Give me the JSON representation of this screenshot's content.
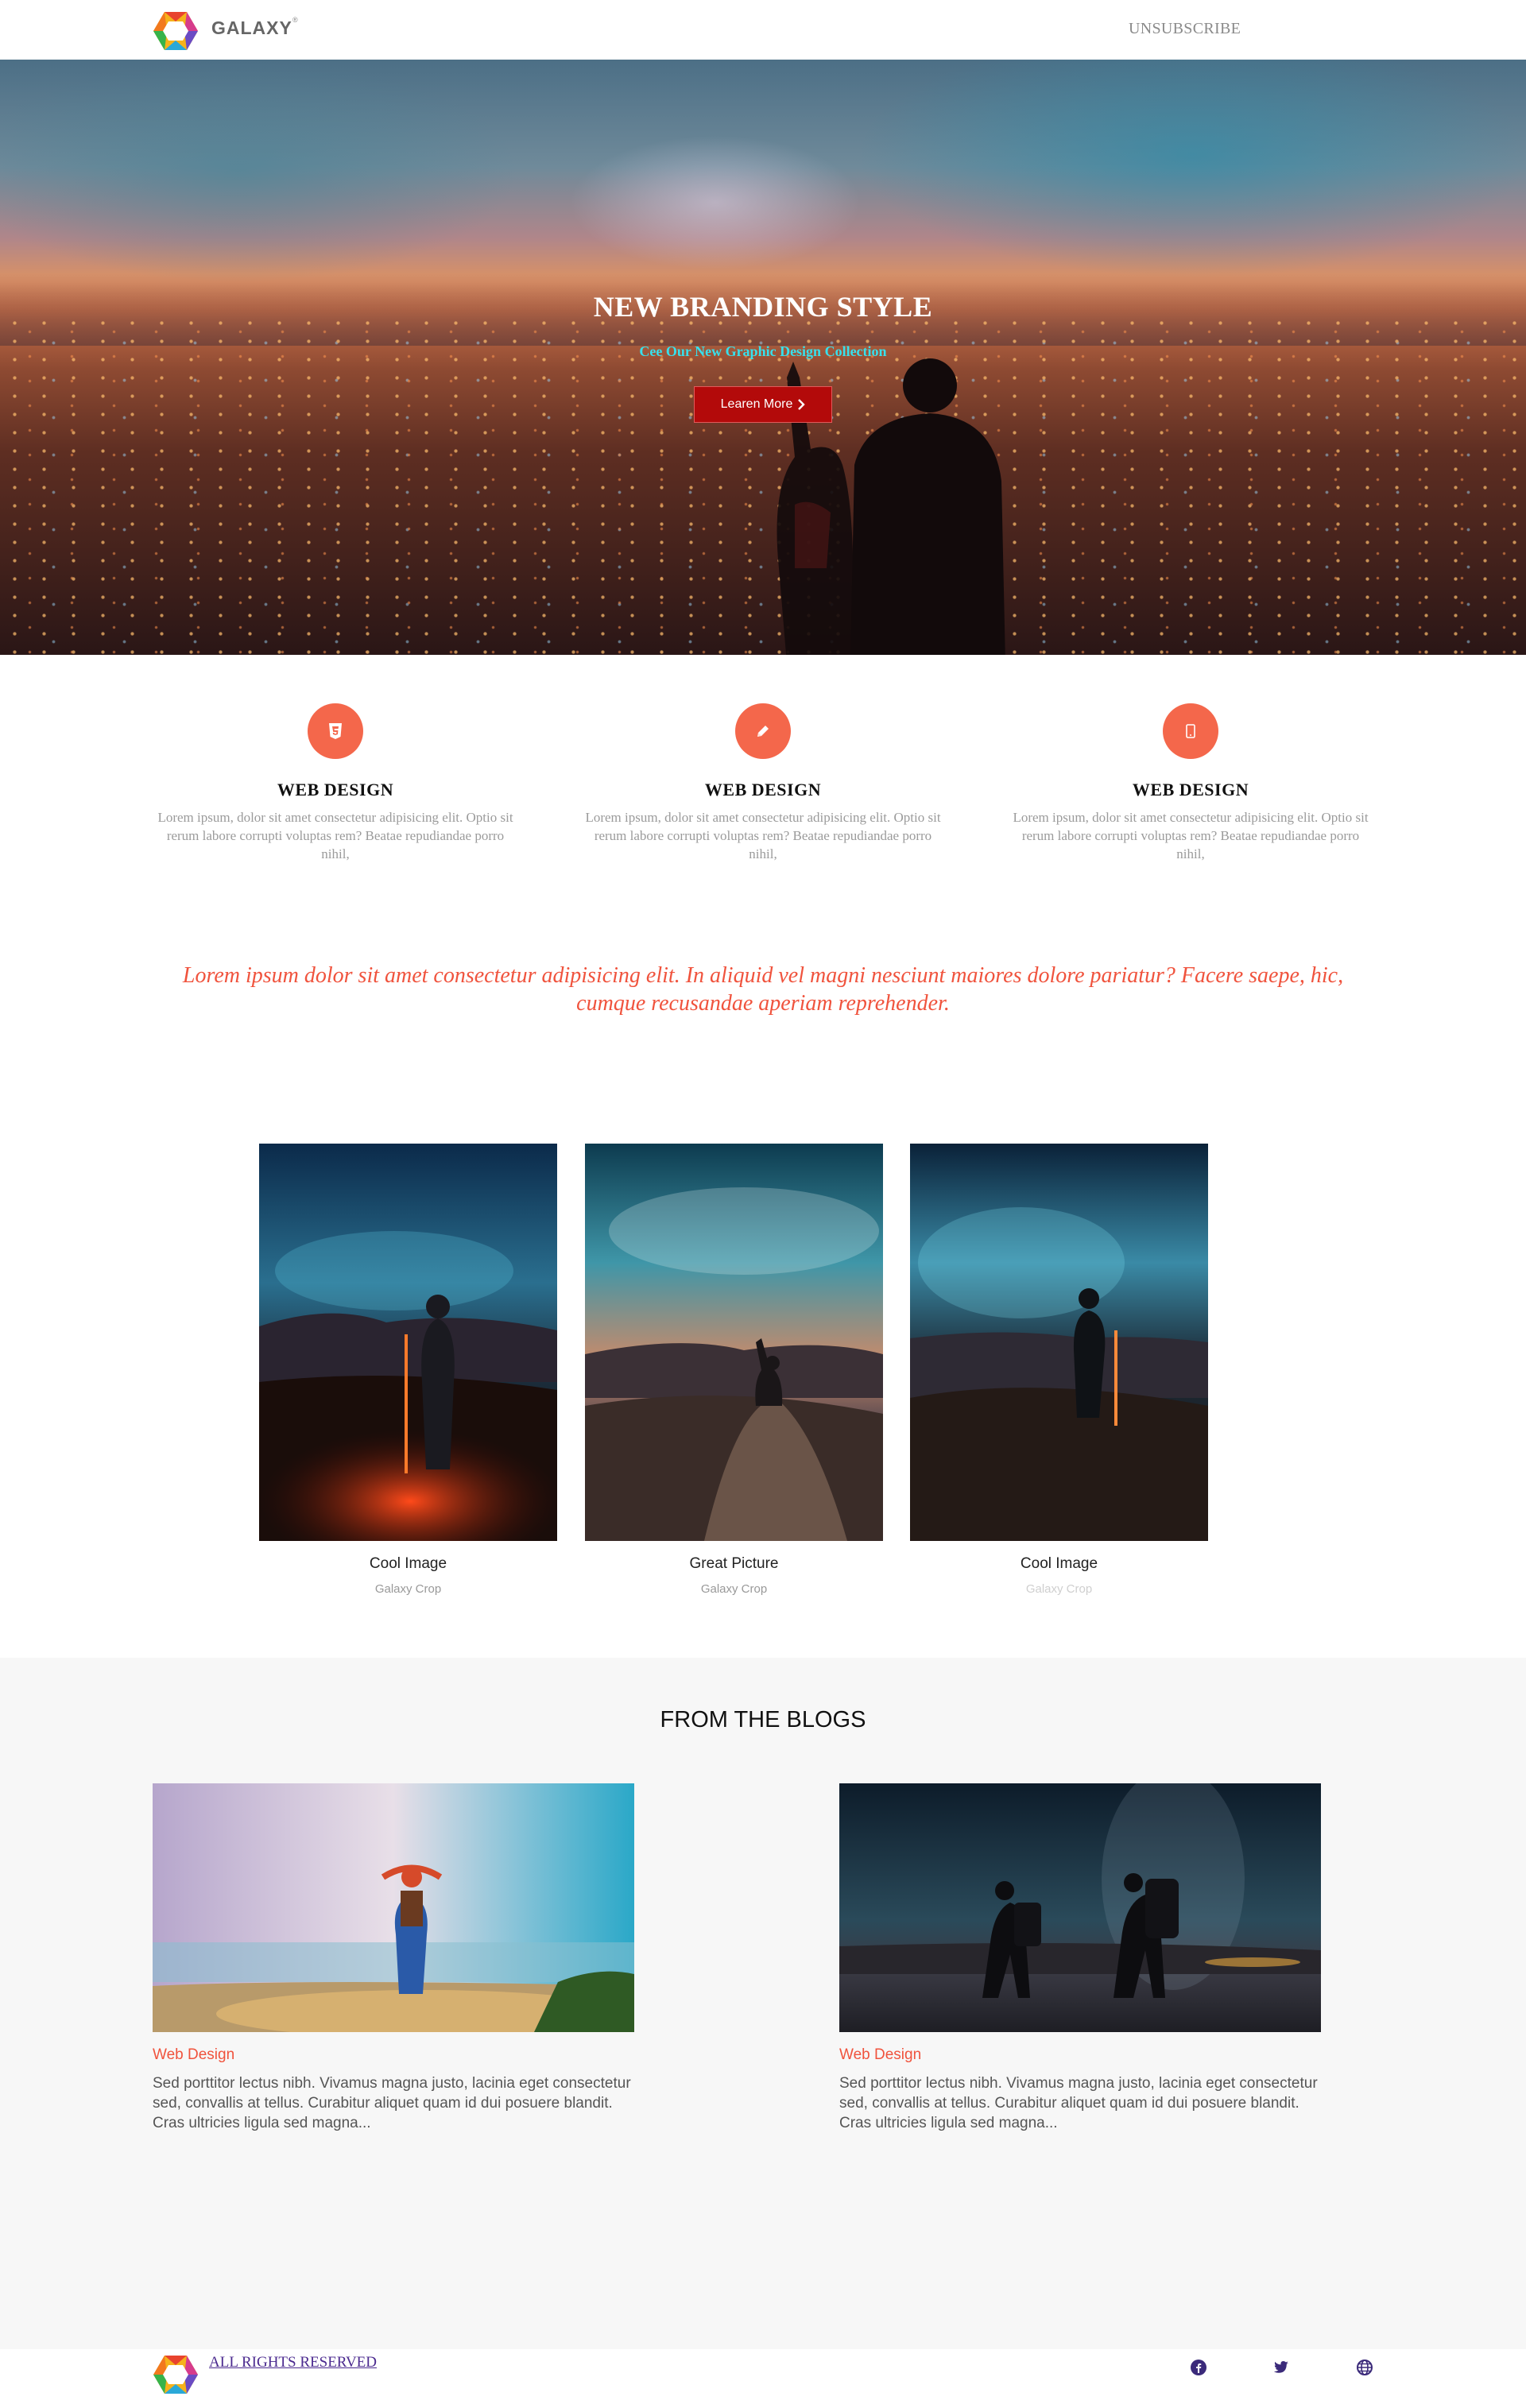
{
  "nav": {
    "brand": "GALAXY",
    "brand_mark": "®",
    "unsubscribe": "UNSUBSCRIBE"
  },
  "hero": {
    "title": "NEW BRANDING STYLE",
    "subtitle": "Cee Our New Graphic Design Collection",
    "button": "Learen More"
  },
  "features": [
    {
      "icon": "html5-icon",
      "title": "WEB DESIGN",
      "text": "Lorem ipsum, dolor sit amet consectetur adipisicing elit. Optio sit rerum labore corrupti voluptas rem? Beatae repudiandae porro nihil,"
    },
    {
      "icon": "pencil-icon",
      "title": "WEB DESIGN",
      "text": "Lorem ipsum, dolor sit amet consectetur adipisicing elit. Optio sit rerum labore corrupti voluptas rem? Beatae repudiandae porro nihil,"
    },
    {
      "icon": "mobile-icon",
      "title": "WEB DESIGN",
      "text": "Lorem ipsum, dolor sit amet consectetur adipisicing elit. Optio sit rerum labore corrupti voluptas rem? Beatae repudiandae porro nihil,"
    }
  ],
  "quote": "Lorem ipsum dolor sit amet consectetur adipisicing elit. In aliquid vel magni nesciunt maiores dolore pariatur? Facere saepe, hic, cumque recusandae aperiam reprehender.",
  "gallery": [
    {
      "caption": "Cool Image",
      "sub": "Galaxy Crop"
    },
    {
      "caption": "Great Picture",
      "sub": "Galaxy Crop"
    },
    {
      "caption": "Cool Image",
      "sub": "Galaxy Crop"
    }
  ],
  "blogs": {
    "title": "FROM THE BLOGS",
    "posts": [
      {
        "tag": "Web Design",
        "text": "Sed porttitor lectus nibh. Vivamus magna justo, lacinia eget consectetur sed, convallis at tellus. Curabitur aliquet quam id dui posuere blandit. Cras ultricies ligula sed magna..."
      },
      {
        "tag": "Web Design",
        "text": "Sed porttitor lectus nibh. Vivamus magna justo, lacinia eget consectetur sed, convallis at tellus. Curabitur aliquet quam id dui posuere blandit. Cras ultricies ligula sed magna..."
      }
    ]
  },
  "footer": {
    "rights": "ALL RIGHTS RESERVED",
    "social": [
      "facebook-icon",
      "twitter-icon",
      "globe-icon"
    ]
  },
  "colors": {
    "accent": "#f4674b",
    "quote": "#f0533d",
    "button": "#b30a0a",
    "subtitle": "#37e0ec",
    "footer_link": "#4b2a8f"
  }
}
